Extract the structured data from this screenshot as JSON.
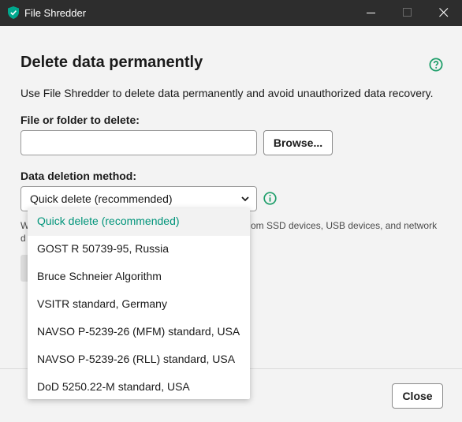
{
  "window": {
    "title": "File Shredder",
    "app_icon": "shield-check-icon",
    "controls": [
      "minimize-icon",
      "maximize-icon",
      "close-icon"
    ]
  },
  "page": {
    "heading": "Delete data permanently",
    "help_icon": "help-icon",
    "description": "Use File Shredder to delete data permanently and avoid unauthorized data recovery."
  },
  "file_section": {
    "label": "File or folder to delete:",
    "input_value": "",
    "browse_label": "Browse..."
  },
  "method_section": {
    "label": "Data deletion method:",
    "selected": "Quick delete (recommended)",
    "info_icon": "info-icon",
    "note_fragments": [
      "W",
      "om SSD devices, USB devices, and network",
      "d"
    ]
  },
  "dropdown": {
    "options": [
      "Quick delete (recommended)",
      "GOST R 50739-95, Russia",
      "Bruce Schneier Algorithm",
      "VSITR standard, Germany",
      "NAVSO P-5239-26 (MFM) standard, USA",
      "NAVSO P-5239-26 (RLL) standard, USA",
      "DoD 5250.22-M standard, USA"
    ],
    "selected_index": 0
  },
  "footer": {
    "close_label": "Close"
  },
  "colors": {
    "accent": "#00947a",
    "titlebar": "#2d2d2d",
    "background": "#f3f3f3",
    "info": "#1e9e6a"
  }
}
